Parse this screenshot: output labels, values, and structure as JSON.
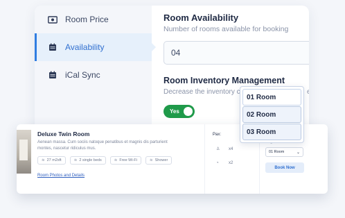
{
  "sidebar": {
    "items": [
      {
        "label": "Room Price",
        "icon": "money-icon"
      },
      {
        "label": "Availability",
        "icon": "calendar-icon",
        "active": true
      },
      {
        "label": "iCal Sync",
        "icon": "calendar-icon"
      }
    ]
  },
  "availability": {
    "title": "Room Availability",
    "description": "Number of rooms available for booking",
    "value": "04"
  },
  "inventory": {
    "title": "Room Inventory Management",
    "description_visible": "Decrease the inventory co",
    "description_tail": "e",
    "toggle_label": "Yes"
  },
  "room_dropdown": {
    "options": [
      "01 Room",
      "02 Room",
      "03 Room"
    ]
  },
  "room_card": {
    "title": "Deluxe Twin Room",
    "description": "Aenean massa. Cum sociis natoque penatibus et magnis dis parturient montes, nascetur ridiculus mus.",
    "amenities": [
      "27 m2sft",
      "2 single beds",
      "Free Wi-Fi",
      "Shower"
    ],
    "link": "Room Photos and Details",
    "pax_label": "Pax:",
    "adults": "x4",
    "children": "x2",
    "per_night": "/night",
    "room_select": "01 Room",
    "book_label": "Book Now"
  },
  "colors": {
    "accent": "#2f7de1",
    "toggle": "#1f9a4a",
    "active_bg": "#e6f0fb"
  }
}
